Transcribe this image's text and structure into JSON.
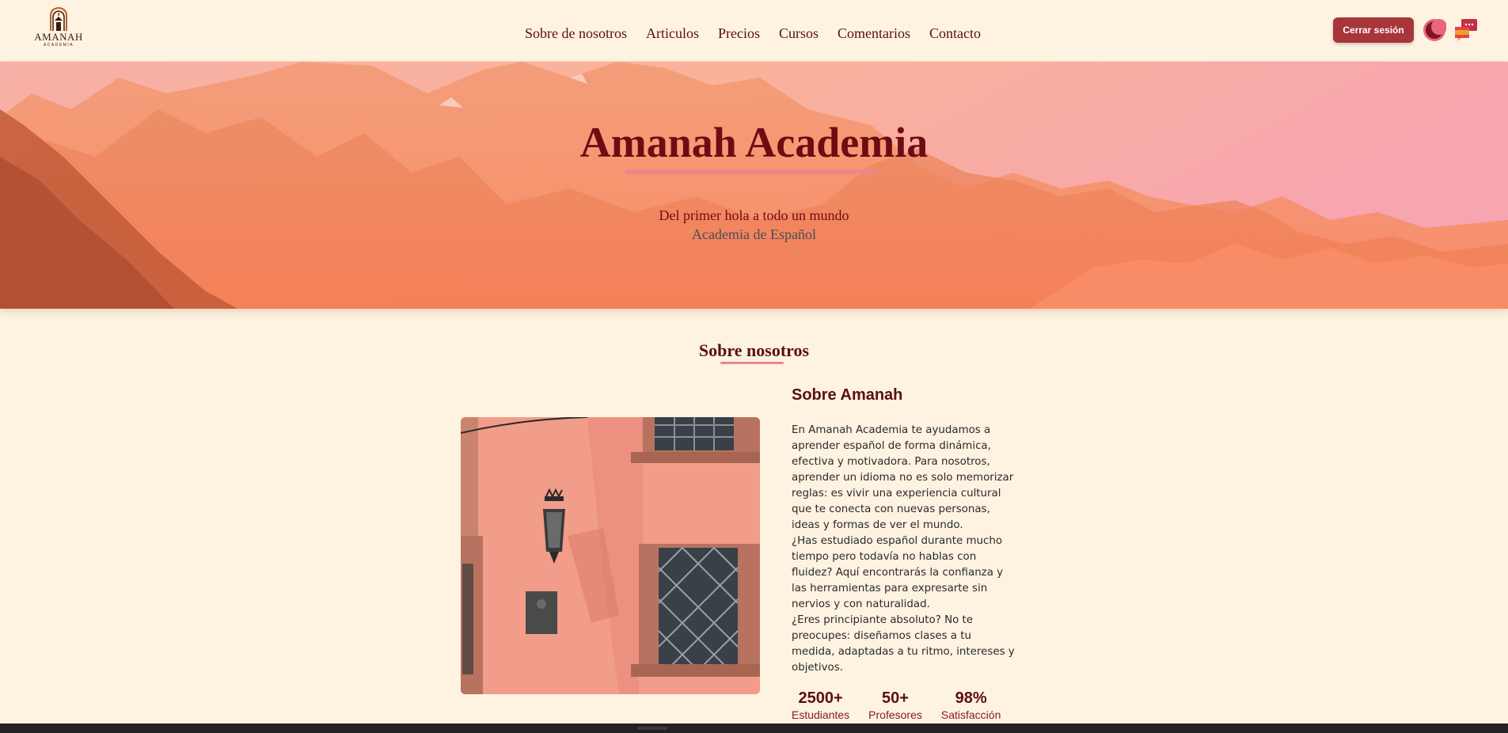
{
  "brand": {
    "name": "AMANAH",
    "sub": "ACADEMIA"
  },
  "nav": {
    "items": [
      {
        "label": "Sobre de nosotros"
      },
      {
        "label": "Articulos"
      },
      {
        "label": "Precios"
      },
      {
        "label": "Cursos"
      },
      {
        "label": "Comentarios"
      },
      {
        "label": "Contacto"
      }
    ],
    "logout_label": "Cerrar sesión",
    "theme_icon": "moon-icon",
    "language_icon": "language-flags-icon"
  },
  "hero": {
    "title": "Amanah Academia",
    "tagline": "Del primer hola a todo un mundo",
    "subtitle": "Academia de Español"
  },
  "about": {
    "section_title": "Sobre nosotros",
    "heading": "Sobre Amanah",
    "paragraphs": [
      "En Amanah Academia te ayudamos a aprender español de forma dinámica, efectiva y motivadora. Para nosotros, aprender un idioma no es solo memorizar reglas: es vivir una experiencia cultural que te conecta con nuevas personas, ideas y formas de ver el mundo.",
      "¿Has estudiado español durante mucho tiempo pero todavía no hablas con fluidez? Aquí encontrarás la confianza y las herramientas para expresarte sin nervios y con naturalidad.",
      "¿Eres principiante absoluto? No te preocupes: diseñamos clases a tu medida, adaptadas a tu ritmo, intereses y objetivos."
    ],
    "stats": [
      {
        "value": "2500+",
        "label": "Estudiantes"
      },
      {
        "value": "50+",
        "label": "Profesores"
      },
      {
        "value": "98%",
        "label": "Satisfacción"
      }
    ]
  },
  "colors": {
    "background": "#fdf3e0",
    "accent": "#a8353a",
    "title": "#6e0c14",
    "underline": "#f0858a"
  }
}
